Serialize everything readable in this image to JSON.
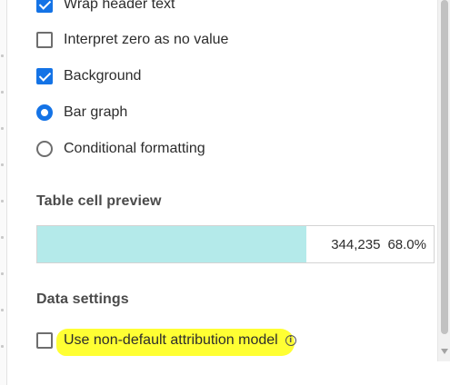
{
  "options": [
    {
      "type": "checkbox",
      "checked": true,
      "label": "Wrap header text"
    },
    {
      "type": "checkbox",
      "checked": false,
      "label": "Interpret zero as no value"
    },
    {
      "type": "checkbox",
      "checked": true,
      "label": "Background"
    },
    {
      "type": "radio",
      "checked": true,
      "label": "Bar graph"
    },
    {
      "type": "radio",
      "checked": false,
      "label": "Conditional formatting"
    }
  ],
  "preview": {
    "title": "Table cell preview",
    "value": "344,235",
    "percent": "68.0%",
    "bar_fraction": 0.68,
    "bar_color": "#b4eaea"
  },
  "data_settings": {
    "title": "Data settings",
    "attribution_checkbox_checked": false,
    "attribution_label": "Use non-default attribution model",
    "info_icon": "info-icon"
  },
  "colors": {
    "accent": "#1473e6",
    "highlight": "#ffff33"
  }
}
